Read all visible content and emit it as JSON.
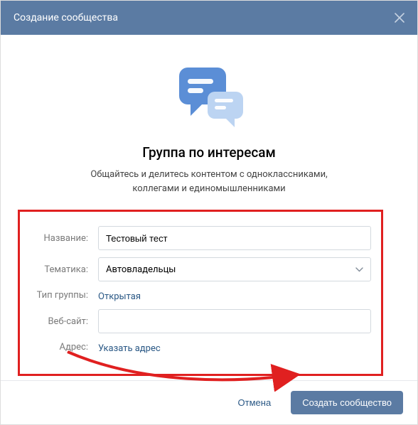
{
  "header": {
    "title": "Создание сообщества"
  },
  "illustration": {
    "alt": "chat-bubbles"
  },
  "heading": "Группа по интересам",
  "subheading": "Общайтесь и делитесь контентом с одноклассниками, коллегами и единомышленниками",
  "form": {
    "name": {
      "label": "Название:",
      "value": "Тестовый тест"
    },
    "topic": {
      "label": "Тематика:",
      "value": "Автовладельцы"
    },
    "group_type": {
      "label": "Тип группы:",
      "value": "Открытая"
    },
    "website": {
      "label": "Веб-сайт:",
      "value": ""
    },
    "address": {
      "label": "Адрес:",
      "value": "Указать адрес"
    }
  },
  "footer": {
    "cancel": "Отмена",
    "submit": "Создать сообщество"
  },
  "colors": {
    "header_bg": "#5b7ba3",
    "primary_btn": "#5b7ba3",
    "link": "#2a5885",
    "highlight_border": "#e02020"
  }
}
